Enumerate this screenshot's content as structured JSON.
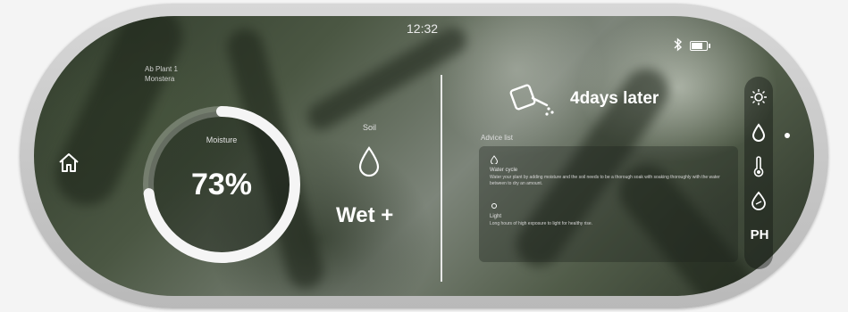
{
  "status_bar": {
    "time": "12:32"
  },
  "plant": {
    "name_line1": "Ab Plant 1",
    "name_line2": "Monstera"
  },
  "moisture": {
    "label": "Moisture",
    "value": "73%",
    "percent": 73
  },
  "soil": {
    "label": "Soil",
    "value": "Wet +"
  },
  "watering": {
    "next": "4days later"
  },
  "advice": {
    "title": "Advice list",
    "items": [
      {
        "name": "Water cycle",
        "text": "Water your plant by adding moisture and the soil needs to be a thorough soak with soaking thoroughly with the water between to dry an amount."
      },
      {
        "name": "Light",
        "text": "Long hours of high exposure to light for healthy rise."
      }
    ]
  },
  "side_menu": {
    "ph_label": "PH"
  },
  "colors": {
    "accent": "#ffffff",
    "panel": "#1e231e"
  }
}
